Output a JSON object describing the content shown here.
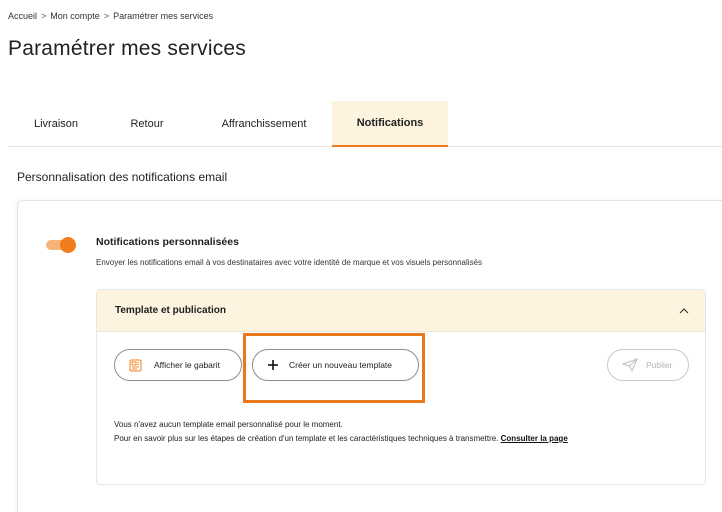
{
  "breadcrumb": {
    "items": [
      "Accueil",
      "Mon compte",
      "Paramétrer mes services"
    ],
    "separator": ">"
  },
  "page": {
    "title": "Paramétrer mes services"
  },
  "tabs": [
    {
      "label": "Livraison",
      "active": false
    },
    {
      "label": "Retour",
      "active": false
    },
    {
      "label": "Affranchissement",
      "active": false
    },
    {
      "label": "Notifications",
      "active": true
    }
  ],
  "section": {
    "title": "Personnalisation des notifications email"
  },
  "notifications": {
    "toggle_on": true,
    "title": "Notifications personnalisées",
    "description": "Envoyer les notifications email à vos destinataires avec votre identité de marque et vos visuels personnalisés"
  },
  "accordion": {
    "title": "Template et publication",
    "expanded": true,
    "buttons": {
      "view_template": "Afficher le gabarit",
      "create_template": "Créer un nouveau template",
      "publish": "Publier"
    },
    "info_line1": "Vous n'avez aucun template email personnalisé pour le moment.",
    "info_line2": "Pour en savoir plus sur les étapes de création d'un template et les caractéristiques techniques à transmettre.",
    "info_link": "Consulter la page"
  },
  "colors": {
    "accent": "#f07c1e",
    "tab_active_bg": "#fdf3df",
    "highlight_border": "#e8781c"
  }
}
